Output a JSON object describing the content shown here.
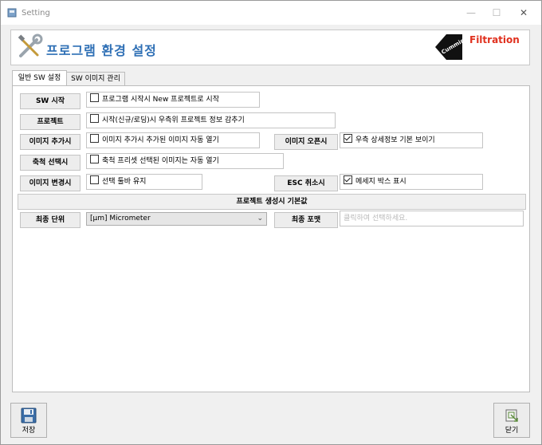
{
  "window": {
    "title": "Setting",
    "controls": {
      "minimize": "—",
      "maximize": "☐",
      "close": "✕"
    }
  },
  "header": {
    "title": "프로그램 환경 설정",
    "brand": "Filtration",
    "logo_icon": "cummins-logo",
    "tools_icon": "tools-icon"
  },
  "tabs": [
    {
      "label": "일반 SW 설정",
      "active": true
    },
    {
      "label": "SW 이미지 관리",
      "active": false
    }
  ],
  "settings": {
    "sw_start": {
      "label": "SW 시작",
      "option": "프로그램 시작시 New 프로젝트로 시작",
      "checked": false
    },
    "project": {
      "label": "프로젝트",
      "option": "시작(신규/로딩)시 우측위 프로젝트 정보 감추기",
      "checked": false
    },
    "image_add": {
      "label": "이미지 추가시",
      "option": "이미지 추가시 추가된 이미지 자동 열기",
      "checked": false
    },
    "image_open": {
      "label": "이미지 오픈시",
      "option": "우측 상세정보 기본 보이기",
      "checked": true
    },
    "scale_select": {
      "label": "축척 선택시",
      "option": "축척 프리셋 선택된 이미지는 자동 열기",
      "checked": false
    },
    "image_change": {
      "label": "이미지 변경시",
      "option": "선택 툴바 유지",
      "checked": false
    },
    "esc_cancel": {
      "label": "ESC 취소시",
      "option": "메세지 박스 표시",
      "checked": true
    }
  },
  "project_defaults": {
    "section_title": "프로젝트 생성시 기본값",
    "unit_label": "최종 단위",
    "unit_value": "[μm] Micrometer",
    "format_label": "최종 포맷",
    "format_placeholder": "클릭하여 선택하세요."
  },
  "footer": {
    "save_label": "저장",
    "close_label": "닫기"
  },
  "colors": {
    "header_title": "#2e6fb5",
    "brand": "#e0301e",
    "save_icon": "#3b6ea8"
  }
}
